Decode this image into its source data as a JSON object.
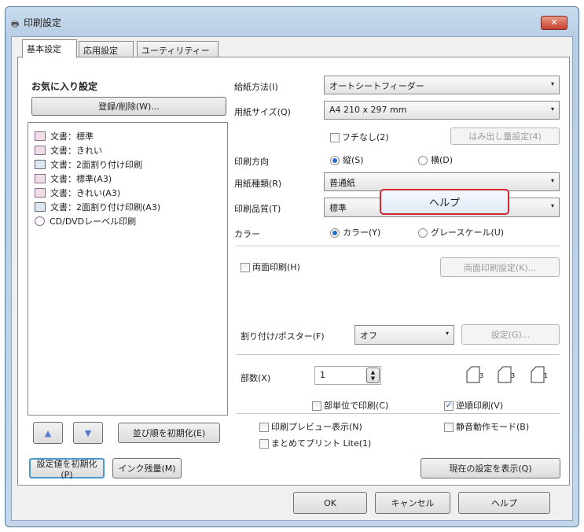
{
  "window": {
    "title": "印刷設定",
    "close": "✕"
  },
  "tabs": [
    "基本設定",
    "応用設定",
    "ユーティリティー"
  ],
  "favorites": {
    "heading": "お気に入り設定",
    "register_button": "登録/削除(W)...",
    "items": [
      {
        "icon": "document-icon",
        "label": "文書：標準"
      },
      {
        "icon": "document-fine-icon",
        "label": "文書：きれい"
      },
      {
        "icon": "layout-2up-icon",
        "label": "文書：2面割り付け印刷"
      },
      {
        "icon": "document-icon",
        "label": "文書：標準(A3)"
      },
      {
        "icon": "document-fine-icon",
        "label": "文書：きれい(A3)"
      },
      {
        "icon": "layout-2up-icon",
        "label": "文書：2面割り付け印刷(A3)"
      },
      {
        "icon": "disc-icon",
        "label": "CD/DVDレーベル印刷"
      }
    ],
    "up": "▲",
    "down": "▼",
    "reset_order": "並び順を初期化(E)"
  },
  "settings": {
    "paper_source_label": "給紙方法(I)",
    "paper_source": "オートシートフィーダー",
    "paper_size_label": "用紙サイズ(Q)",
    "paper_size": "A4 210 x 297 mm",
    "borderless": "フチなし(2)",
    "overflow_button": "はみ出し量設定(4)",
    "orientation_label": "印刷方向",
    "portrait": "縦(S)",
    "landscape": "横(D)",
    "paper_type_label": "用紙種類(R)",
    "paper_type": "普通紙",
    "quality_label": "印刷品質(T)",
    "quality": "標準",
    "color_label": "カラー",
    "color": "カラー(Y)",
    "grayscale": "グレースケール(U)",
    "duplex": "両面印刷(H)",
    "duplex_settings": "両面印刷設定(K)...",
    "layout_label": "割り付け/ポスター(F)",
    "layout": "オフ",
    "layout_settings": "設定(G)...",
    "copies_label": "部数(X)",
    "copies": "1",
    "collate": "部単位で印刷(C)",
    "reverse": "逆順印刷(V)",
    "preview": "印刷プレビュー表示(N)",
    "quiet": "静音動作モード(B)",
    "print_lite": "まとめてプリント Lite(1)",
    "show_current": "現在の設定を表示(Q)"
  },
  "tooltip": "ヘルプ",
  "bottom": {
    "reset_settings": "設定値を初期化(P)",
    "ink_levels": "インク残量(M)",
    "ok": "OK",
    "cancel": "キャンセル",
    "help": "ヘルプ"
  },
  "arrow": "▾",
  "check": "✓"
}
